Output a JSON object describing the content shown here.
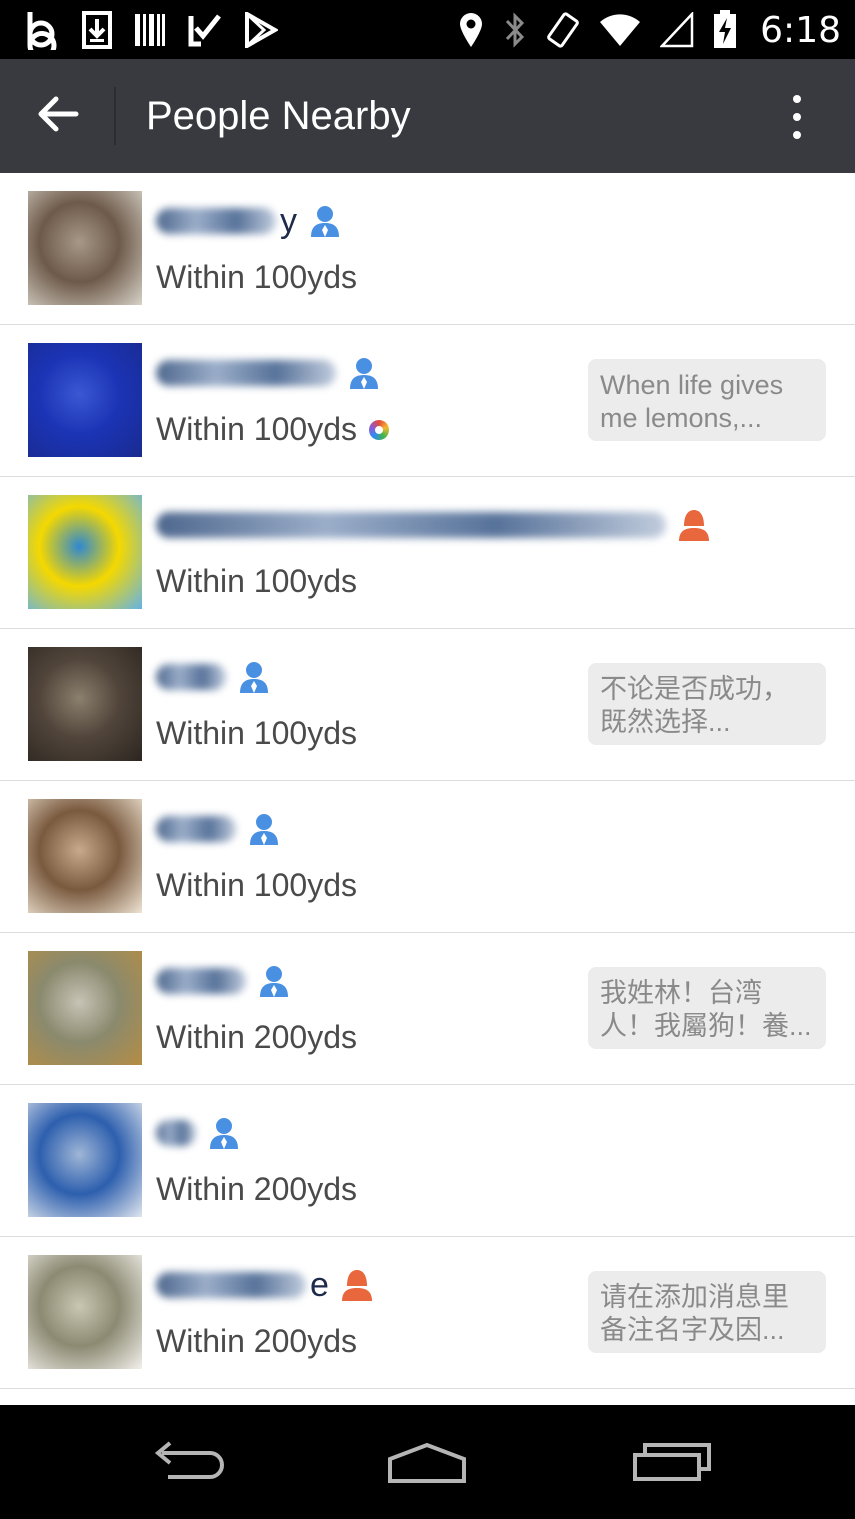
{
  "status_bar": {
    "time": "6:18",
    "left_icons": [
      "bing-icon",
      "download-icon",
      "barcode-icon",
      "checkmark-app-icon",
      "play-store-icon"
    ],
    "right_icons": [
      "location-icon",
      "bluetooth-icon",
      "rotation-icon",
      "wifi-icon",
      "signal-icon",
      "battery-charging-icon"
    ]
  },
  "action_bar": {
    "title": "People Nearby",
    "background": "#393a3f"
  },
  "people": [
    {
      "name_suffix": "y",
      "gender": "male",
      "distance": "Within 100yds",
      "moments": false,
      "status": "",
      "avatar_colors": [
        "#6e5a4a",
        "#a79887",
        "#d7d3c8"
      ]
    },
    {
      "name_suffix": "",
      "gender": "male",
      "distance": "Within 100yds",
      "moments": true,
      "status": "When life gives me lemons,...",
      "avatar_colors": [
        "#1b34b6",
        "#3b58d3",
        "#1a2a8f"
      ]
    },
    {
      "name_suffix": "",
      "gender": "female",
      "distance": "Within 100yds",
      "moments": false,
      "status": "",
      "avatar_colors": [
        "#f4d800",
        "#2f88d0",
        "#64b3e6"
      ]
    },
    {
      "name_suffix": "",
      "gender": "male",
      "distance": "Within 100yds",
      "moments": false,
      "status": "不论是否成功，既然选择...",
      "avatar_colors": [
        "#51453b",
        "#8b7f6d",
        "#2c2620"
      ]
    },
    {
      "name_suffix": "",
      "gender": "male",
      "distance": "Within 100yds",
      "moments": false,
      "status": "",
      "avatar_colors": [
        "#7a5a3f",
        "#c9a98a",
        "#efe4d3"
      ]
    },
    {
      "name_suffix": "",
      "gender": "male",
      "distance": "Within 200yds",
      "moments": false,
      "status": "我姓林！台湾人！我屬狗！養...",
      "avatar_colors": [
        "#8a8a6e",
        "#c7c3b6",
        "#b58d44"
      ]
    },
    {
      "name_suffix": "",
      "gender": "male",
      "distance": "Within 200yds",
      "moments": false,
      "status": "",
      "avatar_colors": [
        "#2d5fae",
        "#9fb6d6",
        "#e0e6ee"
      ]
    },
    {
      "name_suffix": "e",
      "gender": "female",
      "distance": "Within 200yds",
      "moments": false,
      "status": "请在添加消息里备注名字及因...",
      "avatar_colors": [
        "#8c8a72",
        "#c9c6b2",
        "#f3f1ec"
      ]
    }
  ],
  "colors": {
    "male": "#4a90e2",
    "female": "#e8673c"
  },
  "nav_bar": {
    "buttons": [
      "back-nav-icon",
      "home-nav-icon",
      "recents-nav-icon"
    ]
  }
}
